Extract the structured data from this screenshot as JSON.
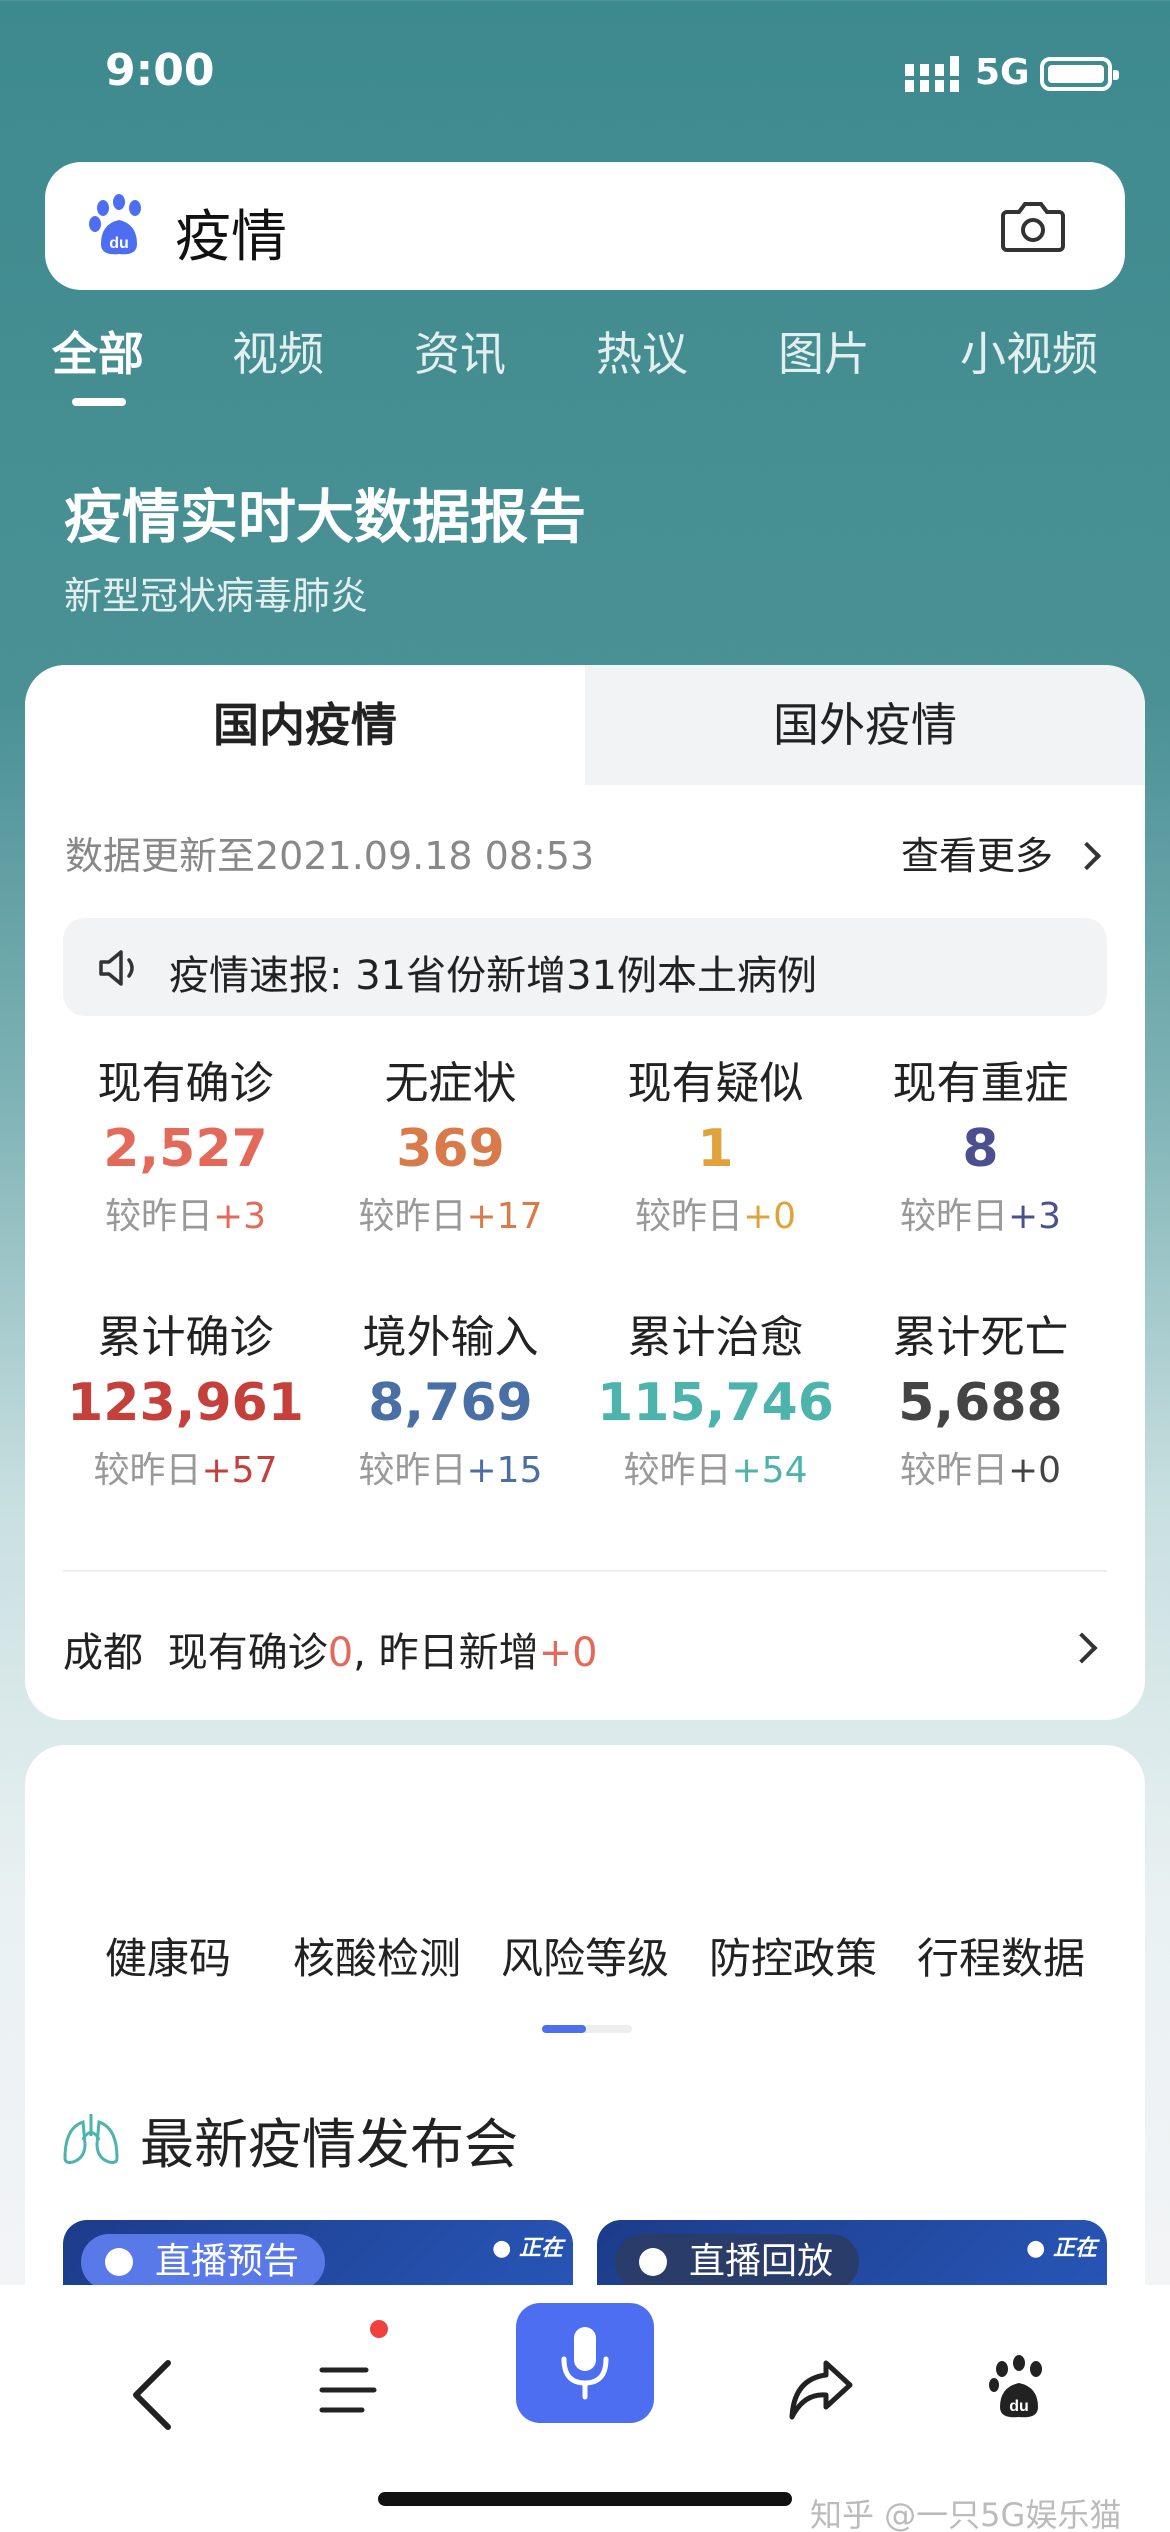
{
  "status": {
    "time": "9:00",
    "network": "5G"
  },
  "search": {
    "query": "疫情"
  },
  "tabs": [
    "全部",
    "视频",
    "资讯",
    "热议",
    "图片",
    "小视频"
  ],
  "report": {
    "title": "疫情实时大数据报告",
    "subtitle": "新型冠状病毒肺炎"
  },
  "card": {
    "tab_domestic": "国内疫情",
    "tab_foreign": "国外疫情",
    "update_time": "数据更新至2021.09.18 08:53",
    "see_more": "查看更多",
    "news_flash": "疫情速报: 31省份新增31例本土病例"
  },
  "stats": [
    {
      "label": "现有确诊",
      "value": "2,527",
      "delta_prefix": "较昨日",
      "delta": "+3",
      "color": "#e36a5a",
      "delta_color": "#e36a5a"
    },
    {
      "label": "无症状",
      "value": "369",
      "delta_prefix": "较昨日",
      "delta": "+17",
      "color": "#d97a4a",
      "delta_color": "#d97a4a"
    },
    {
      "label": "现有疑似",
      "value": "1",
      "delta_prefix": "较昨日",
      "delta": "+0",
      "color": "#e0a23a",
      "delta_color": "#e0a23a"
    },
    {
      "label": "现有重症",
      "value": "8",
      "delta_prefix": "较昨日",
      "delta": "+3",
      "color": "#4b4f8f",
      "delta_color": "#4b4f8f"
    },
    {
      "label": "累计确诊",
      "value": "123,961",
      "delta_prefix": "较昨日",
      "delta": "+57",
      "color": "#c5403a",
      "delta_color": "#c5403a"
    },
    {
      "label": "境外输入",
      "value": "8,769",
      "delta_prefix": "较昨日",
      "delta": "+15",
      "color": "#4a6fa5",
      "delta_color": "#4a6fa5"
    },
    {
      "label": "累计治愈",
      "value": "115,746",
      "delta_prefix": "较昨日",
      "delta": "+54",
      "color": "#4db3ad",
      "delta_color": "#4db3ad"
    },
    {
      "label": "累计死亡",
      "value": "5,688",
      "delta_prefix": "较昨日",
      "delta": "+0",
      "color": "#444444",
      "delta_color": "#444444"
    }
  ],
  "city": {
    "name": "成都",
    "current_label": "现有确诊",
    "current_value": "0",
    "sep": ", ",
    "new_label": "昨日新增",
    "new_value": "+0"
  },
  "services": [
    "健康码",
    "核酸检测",
    "风险等级",
    "防控政策",
    "行程数据"
  ],
  "press": {
    "title": "最新疫情发布会",
    "cards": [
      {
        "badge": "直播预告",
        "badge_color": "#5a79e8"
      },
      {
        "badge": "直播回放",
        "badge_color": "#2a3c6a"
      }
    ]
  },
  "watermark": "知乎 @一只5G娱乐猫"
}
